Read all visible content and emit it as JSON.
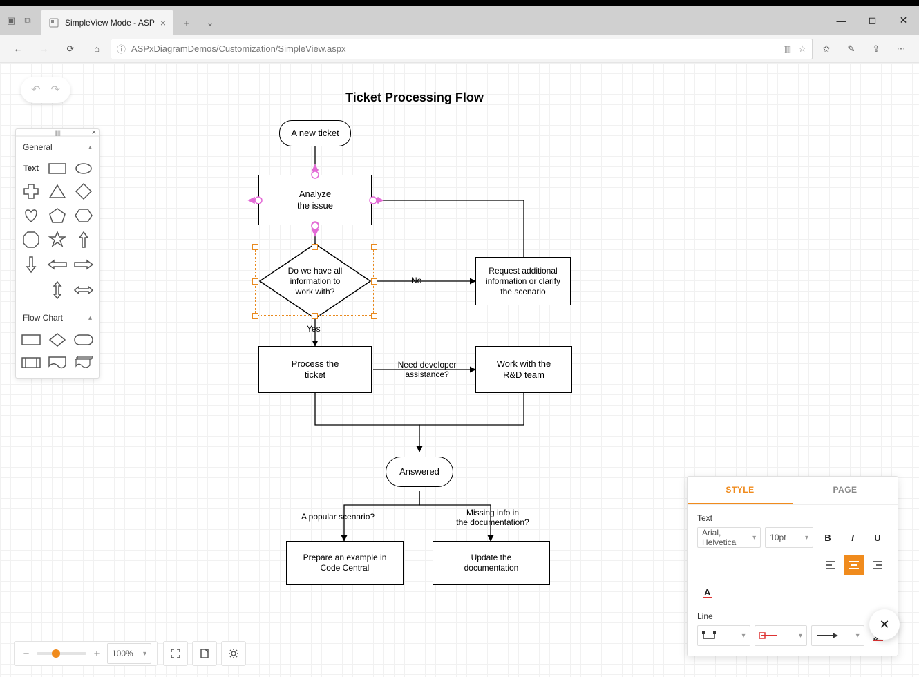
{
  "browser": {
    "tab_title": "SimpleView Mode - ASP",
    "url": "ASPxDiagramDemos/Customization/SimpleView.aspx"
  },
  "diagram": {
    "title": "Ticket Processing Flow",
    "nodes": {
      "new_ticket": "A new ticket",
      "analyze": "Analyze\nthe issue",
      "have_info": "Do we have all\ninformation to\nwork with?",
      "request_info": "Request additional\ninformation or clarify\nthe scenario",
      "process": "Process the\nticket",
      "rd_team": "Work with the\nR&D team",
      "answered": "Answered",
      "example": "Prepare an example in\nCode Central",
      "update_doc": "Update the\ndocumentation"
    },
    "edge_labels": {
      "no": "No",
      "yes": "Yes",
      "need_dev": "Need developer\nassistance?",
      "popular": "A popular scenario?",
      "missing": "Missing info in\nthe documentation?"
    }
  },
  "shapes_panel": {
    "general": "General",
    "text_label": "Text",
    "flowchart": "Flow Chart"
  },
  "props": {
    "tab_style": "STYLE",
    "tab_page": "PAGE",
    "text_section": "Text",
    "font": "Arial, Helvetica",
    "size": "10pt",
    "line_section": "Line"
  },
  "bottom": {
    "zoom": "100%"
  }
}
